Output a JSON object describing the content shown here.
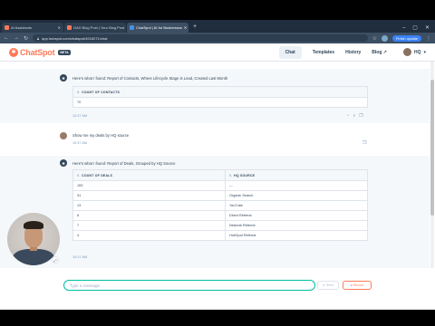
{
  "browser": {
    "tabs": [
      {
        "title": "AI Assistants",
        "active": false
      },
      {
        "title": "GAX Blog Post | Your Blog Post",
        "active": false
      },
      {
        "title": "ChatSpot | AI for Businesses",
        "active": true
      }
    ],
    "new_tab": "+",
    "url": "app.hubspot.com/chatspot/4918271/chat",
    "update_button": "Finish update"
  },
  "header": {
    "logo_text": "ChatSpot",
    "beta_label": "BETA",
    "nav": [
      {
        "label": "Chat",
        "active": true
      },
      {
        "label": "Templates",
        "active": false
      },
      {
        "label": "History",
        "active": false
      },
      {
        "label": "Blog ↗",
        "active": false
      }
    ],
    "user_label": "HQ"
  },
  "chat": {
    "msg1": {
      "text": "Here's what I found: Report of Contacts, Where Lifecycle Stage is Lead, Created Last Month",
      "table": {
        "header": "COUNT OF CONTACTS",
        "rows": [
          [
            "70"
          ]
        ]
      },
      "time": "10:37 AM"
    },
    "msg2": {
      "text": "Show me my deals by HQ source",
      "time": "10:37 AM"
    },
    "msg3": {
      "text": "Here's what I found: Report of Deals, Grouped by HQ Source",
      "table": {
        "headers": [
          "COUNT OF DEALS",
          "HQ SOURCE"
        ],
        "rows": [
          [
            "153",
            "---"
          ],
          [
            "31",
            "Organic Search"
          ],
          [
            "13",
            "YouTube"
          ],
          [
            "6",
            "Direct Referral"
          ],
          [
            "7",
            "Network Referral"
          ],
          [
            "4",
            "HubSpot Referral"
          ]
        ]
      },
      "time": "10:37 AM"
    }
  },
  "composer": {
    "placeholder": "Type a message",
    "send_label": "Send",
    "record_label": "Record"
  },
  "icons": [
    "back-icon",
    "forward-icon",
    "reload-icon",
    "lock-icon",
    "star-icon",
    "copy-icon",
    "share-icon",
    "thumbs-up-icon",
    "thumbs-down-icon",
    "expand-icon"
  ]
}
